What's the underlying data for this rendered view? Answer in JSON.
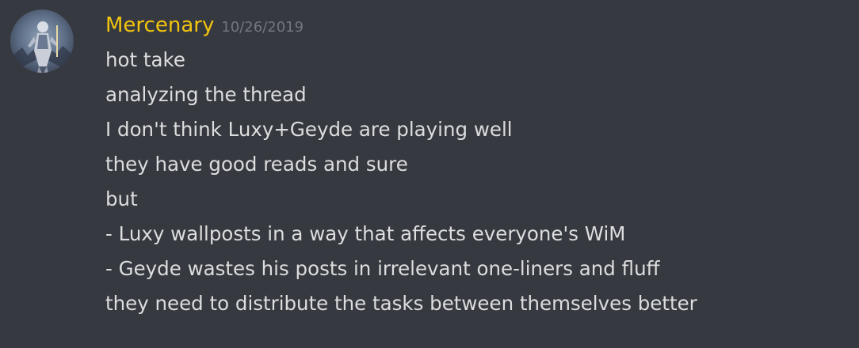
{
  "message": {
    "author": "Mercenary",
    "timestamp": "10/26/2019",
    "author_color": "#f1c40f",
    "avatar_icon": "user-avatar-icon",
    "lines": [
      "hot take",
      "analyzing the thread",
      "I don't think Luxy+Geyde are playing well",
      "they have good reads and sure",
      "but",
      "- Luxy wallposts in a way that affects everyone's WiM",
      "- Geyde wastes his posts in irrelevant one-liners and fluff",
      "they need to distribute the tasks between themselves better"
    ]
  },
  "colors": {
    "background": "#36393f",
    "text": "#dcddde",
    "timestamp": "#72767d"
  }
}
